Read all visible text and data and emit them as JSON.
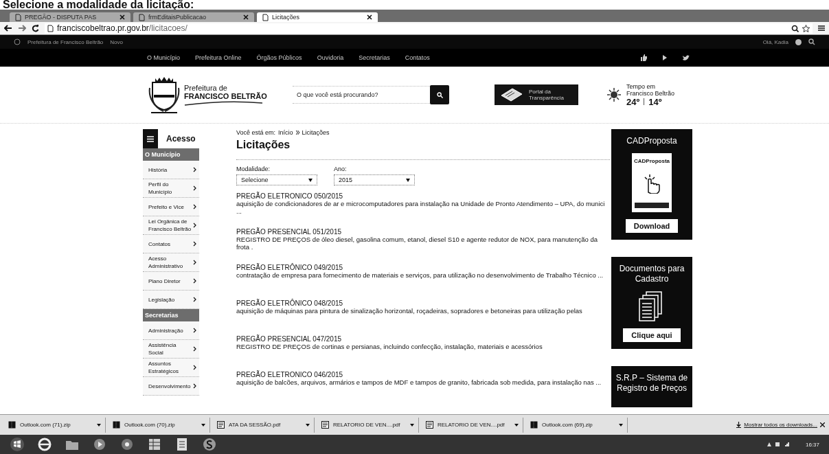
{
  "caption": "Selecione a modalidade da licitação:",
  "browser": {
    "tabs": [
      {
        "label": "PREGÃO - DISPUTA PAS",
        "selected": false
      },
      {
        "label": "frmEditaisPublicacao",
        "selected": false
      },
      {
        "label": "Licitações",
        "selected": true
      }
    ],
    "address": {
      "domain": "franciscobeltrao.pr.gov.br",
      "path": "/licitacoes/"
    }
  },
  "admin_bar": {
    "items": [
      "Prefeitura de Francisco Beltrão",
      "Novo"
    ],
    "user": "Olá, Kadia"
  },
  "nav": {
    "items": [
      "O Município",
      "Prefeitura Online",
      "Órgãos Públicos",
      "Ouvidoria",
      "Secretarias",
      "Contatos"
    ]
  },
  "header": {
    "brand_line1": "Prefeitura de",
    "brand_line2": "FRANCISCO BELTRÃO",
    "search_placeholder": "O que você está procurando?",
    "portal": [
      "Portal da",
      "Transparência"
    ],
    "weather": {
      "label": "Tempo em Francisco Beltrão",
      "max": "24º",
      "min": "14º"
    }
  },
  "sidebar": {
    "title": "Acesso",
    "sections": [
      {
        "heading": "O Município",
        "items": [
          "História",
          "Perfil do Município",
          "Prefeito e Vice",
          "Lei Orgânica de Francisco Beltrão",
          "Contatos",
          "Acesso Administrativo",
          "Plano Diretor",
          "Legislação"
        ]
      },
      {
        "heading": "Secretarias",
        "items": [
          "Administração",
          "Assistência Social",
          "Assuntos Estratégicos",
          "Desenvolvimento"
        ]
      }
    ]
  },
  "breadcrumb": {
    "prefix": "Você está em:",
    "items": [
      "Início",
      "Licitações"
    ]
  },
  "title": "Licitações",
  "filters": [
    {
      "label": "Modalidade:",
      "value": "Selecione"
    },
    {
      "label": "Ano:",
      "value": "2015"
    }
  ],
  "tenders": [
    {
      "title": "PREGÃO ELETRONICO 050/2015",
      "description": "aquisição de condicionadores de ar e microcomputadores para instalação na Unidade de Pronto Atendimento – UPA, do munici ..."
    },
    {
      "title": "PREGÃO PRESENCIAL 051/2015",
      "description": "REGISTRO DE PREÇOS de óleo diesel, gasolina comum, etanol, diesel S10 e agente redutor de NOX, para manutenção da frota ."
    },
    {
      "title": "PREGÃO ELETRÔNICO 049/2015",
      "description": "contratação de empresa para fornecimento de materiais e serviços, para utilização no desenvolvimento de Trabalho Técnico ..."
    },
    {
      "title": "PREGÃO ELETRÔNICO 048/2015",
      "description": "aquisição de máquinas para pintura de sinalização horizontal, roçadeiras,  sopradores e betoneiras para utilização pelas"
    },
    {
      "title": "PREGÃO PRESENCIAL 047/2015",
      "description": "REGISTRO DE PREÇOS de cortinas e persianas, incluindo confecção, instalação, materiais e acessórios"
    },
    {
      "title": "PREGÃO ELETRONICO 046/2015",
      "description": "aquisição de balcões, arquivos, armários e tampos de MDF e tampos de granito, fabricada sob medida, para instalação nas ..."
    }
  ],
  "side_cards": [
    {
      "kind": "download",
      "title": "CADProposta",
      "image_text": "CADProposta",
      "button": "Download"
    },
    {
      "kind": "documents",
      "title": "Documentos para Cadastro",
      "button": "Clique aqui"
    },
    {
      "kind": "plain",
      "title": "S.R.P – Sistema de Registro de Preços"
    }
  ],
  "downloads": {
    "items": [
      {
        "kind": "zip",
        "name": "Outlook.com (71).zip"
      },
      {
        "kind": "zip",
        "name": "Outlook.com (70).zip"
      },
      {
        "kind": "pdf",
        "name": "ATA DA SESSÃO.pdf"
      },
      {
        "kind": "pdf",
        "name": "RELATORIO DE VEN....pdf"
      },
      {
        "kind": "pdf",
        "name": "RELATORIO DE VEN....pdf"
      },
      {
        "kind": "zip",
        "name": "Outlook.com (69).zip"
      }
    ],
    "show_all": "Mostrar todos os downloads..."
  },
  "taskbar": {
    "time": "16:37"
  }
}
